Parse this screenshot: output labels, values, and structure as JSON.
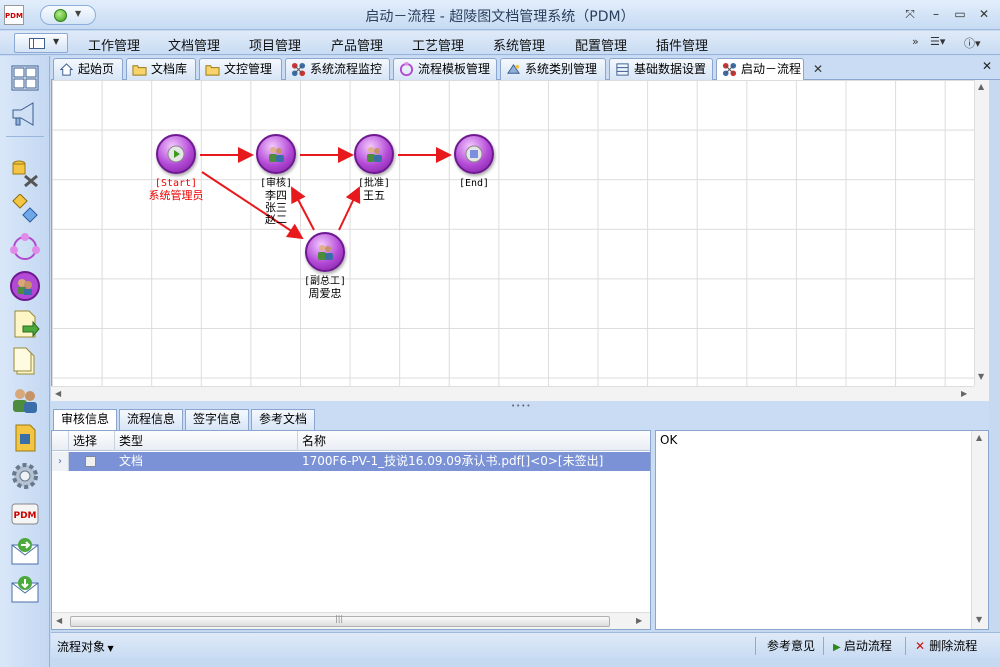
{
  "window": {
    "title": "启动－流程 - 超陵图文档管理系统（PDM）",
    "logo_text": "PDM"
  },
  "menu": {
    "items": [
      "工作管理",
      "文档管理",
      "项目管理",
      "产品管理",
      "工艺管理",
      "系统管理",
      "配置管理",
      "插件管理"
    ]
  },
  "tabs": [
    {
      "label": "起始页",
      "icon": "home-icon"
    },
    {
      "label": "文档库",
      "icon": "folder-icon"
    },
    {
      "label": "文控管理",
      "icon": "folder-icon"
    },
    {
      "label": "系统流程监控",
      "icon": "workflow-icon"
    },
    {
      "label": "流程模板管理",
      "icon": "template-icon"
    },
    {
      "label": "系统类别管理",
      "icon": "category-icon"
    },
    {
      "label": "基础数据设置",
      "icon": "database-icon"
    },
    {
      "label": "启动－流程",
      "icon": "workflow-icon",
      "active": true
    }
  ],
  "workflow": {
    "nodes": [
      {
        "id": "start",
        "role": "[Start]",
        "people": [
          "系统管理员"
        ],
        "color": "red"
      },
      {
        "id": "review",
        "role": "[审核]",
        "people": [
          "李四",
          "张三",
          "赵二"
        ]
      },
      {
        "id": "approve",
        "role": "[批准]",
        "people": [
          "王五"
        ]
      },
      {
        "id": "end",
        "role": "[End]",
        "people": []
      },
      {
        "id": "deputy",
        "role": "[副总工]",
        "people": [
          "周爱忠"
        ]
      }
    ],
    "arrow_color": "#e8191c"
  },
  "bottom_tabs": [
    "审核信息",
    "流程信息",
    "签字信息",
    "参考文档"
  ],
  "grid": {
    "columns": [
      "选择",
      "类型",
      "名称"
    ],
    "rows": [
      {
        "selected": false,
        "type": "文档",
        "name": "1700F6-PV-1_技说16.09.09承认书.pdf[]<0>[未签出]"
      }
    ]
  },
  "comment": {
    "text": "OK"
  },
  "status": {
    "left_label": "流程对象",
    "buttons": [
      "参考意见",
      "启动流程",
      "删除流程"
    ]
  },
  "colors": {
    "accent": "#c5d9f1",
    "selection": "#7b93d6",
    "node": "#b34ad6",
    "start_label": "#e00000"
  }
}
